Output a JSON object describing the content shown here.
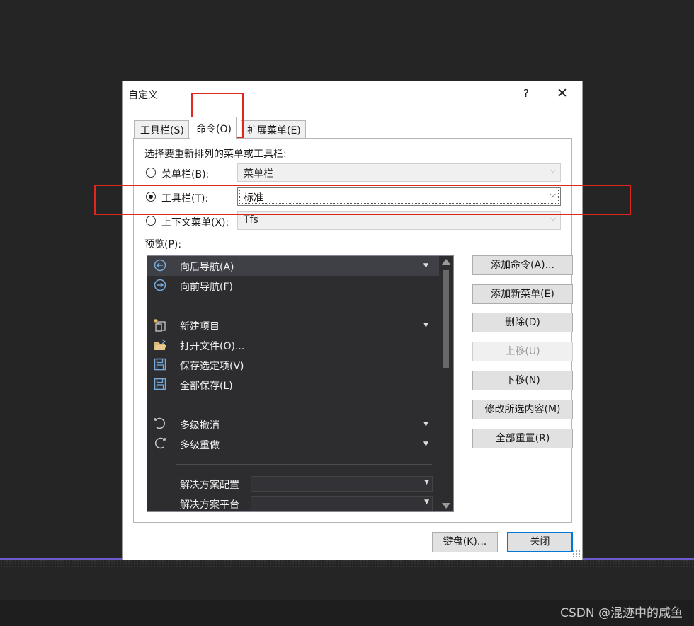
{
  "dialog": {
    "title": "自定义",
    "help_label": "?",
    "close_label": "✕"
  },
  "tabs": [
    {
      "label": "工具栏(S)",
      "active": false
    },
    {
      "label": "命令(O)",
      "active": true
    },
    {
      "label": "扩展菜单(E)",
      "active": false
    }
  ],
  "commands": {
    "heading": "选择要重新排列的菜单或工具栏:",
    "menubar": {
      "label": "菜单栏(B):",
      "value": "菜单栏",
      "checked": false
    },
    "toolbar": {
      "label": "工具栏(T):",
      "value": "标准",
      "checked": true
    },
    "context": {
      "label": "上下文菜单(X):",
      "value": "Tfs",
      "checked": false
    },
    "preview_label": "预览(P):"
  },
  "preview_items": [
    {
      "label": "向后导航(A)",
      "icon": "back-arrow-icon",
      "has_dropdown": true,
      "selected": true
    },
    {
      "label": "向前导航(F)",
      "icon": "forward-arrow-icon",
      "has_dropdown": false
    },
    {
      "label": "新建项目",
      "icon": "new-project-icon",
      "has_dropdown": true
    },
    {
      "label": "打开文件(O)...",
      "icon": "open-folder-icon",
      "has_dropdown": false
    },
    {
      "label": "保存选定项(V)",
      "icon": "save-icon",
      "has_dropdown": false
    },
    {
      "label": "全部保存(L)",
      "icon": "save-all-icon",
      "has_dropdown": false
    },
    {
      "label": "多级撤消",
      "icon": "undo-icon",
      "has_dropdown": true
    },
    {
      "label": "多级重做",
      "icon": "redo-icon",
      "has_dropdown": true
    },
    {
      "label": "解决方案配置",
      "icon": "",
      "has_combo": true
    },
    {
      "label": "解决方案平台",
      "icon": "",
      "has_combo": true
    }
  ],
  "side_buttons": [
    {
      "label": "添加命令(A)...",
      "enabled": true
    },
    {
      "label": "添加新菜单(E)",
      "enabled": true
    },
    {
      "label": "删除(D)",
      "enabled": true
    },
    {
      "label": "上移(U)",
      "enabled": false
    },
    {
      "label": "下移(N)",
      "enabled": true
    },
    {
      "label": "修改所选内容(M)",
      "enabled": true
    },
    {
      "label": "全部重置(R)",
      "enabled": true
    }
  ],
  "footer_buttons": {
    "keyboard": "键盘(K)...",
    "close": "关闭"
  },
  "watermark": "CSDN @混迹中的咸鱼",
  "colors": {
    "highlight": "#e0261f",
    "preview_bg": "#2d2d30",
    "icon_blue": "#75aadb"
  }
}
